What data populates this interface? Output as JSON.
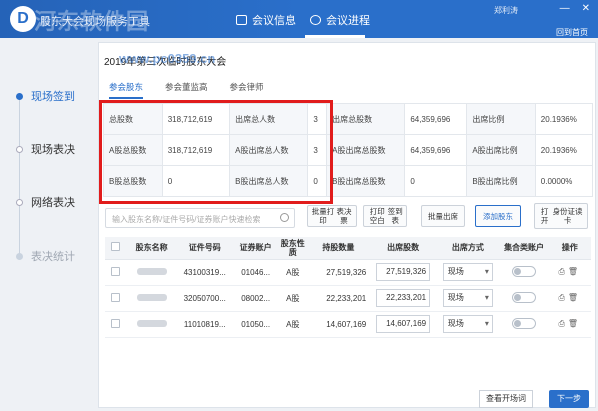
{
  "app": {
    "title": "股东大会现场服务工具",
    "watermark_top": "河东软件园",
    "user": "郑利涛",
    "window_controls": [
      "—",
      "✕"
    ],
    "back_home": "回到首页"
  },
  "nav": {
    "items": [
      {
        "label": "会议信息"
      },
      {
        "label": "会议进程"
      }
    ]
  },
  "sidebar": {
    "items": [
      {
        "label": "现场签到"
      },
      {
        "label": "现场表决"
      },
      {
        "label": "网络表决"
      },
      {
        "label": "表决统计"
      }
    ]
  },
  "main": {
    "meeting_title": "2019年第三次临时股东大会",
    "watermark": "www.pc0359.cn",
    "tabs": [
      {
        "label": "参会股东"
      },
      {
        "label": "参会董监高"
      },
      {
        "label": "参会律师"
      }
    ],
    "stats": [
      [
        "总股数",
        "318,712,619",
        "出席总人数",
        "3",
        "出席总股数",
        "64,359,696",
        "出席比例",
        "20.1936%"
      ],
      [
        "A股总股数",
        "318,712,619",
        "A股出席总人数",
        "3",
        "A股出席总股数",
        "64,359,696",
        "A股出席比例",
        "20.1936%"
      ],
      [
        "B股总股数",
        "0",
        "B股出席总人数",
        "0",
        "B股出席总股数",
        "0",
        "B股出席比例",
        "0.0000%"
      ]
    ],
    "search_placeholder": "输入股东名称/证件号码/证券账户快速检索",
    "buttons": {
      "batch_print": [
        "批量打印",
        "表决票"
      ],
      "print_blank": [
        "打印空白",
        "签到表"
      ],
      "batch_attend": "批量出席",
      "add_holder": "添加股东",
      "print_id": [
        "打开",
        "身份证读卡"
      ]
    },
    "table": {
      "headers": [
        "股东名称",
        "证件号码",
        "证券账户",
        "股东性质",
        "持股数量",
        "出席股数",
        "出席方式",
        "集合类账户",
        "操作"
      ],
      "rows": [
        {
          "id": "43100319...",
          "account": "01046...",
          "type": "A股",
          "holding": "27,519,326",
          "attend": "27,519,326",
          "mode": "现场"
        },
        {
          "id": "32050700...",
          "account": "08002...",
          "type": "A股",
          "holding": "22,233,201",
          "attend": "22,233,201",
          "mode": "现场"
        },
        {
          "id": "11010819...",
          "account": "01050...",
          "type": "A股",
          "holding": "14,607,169",
          "attend": "14,607,169",
          "mode": "现场"
        }
      ]
    },
    "footer": {
      "check_label": "查看开场词",
      "next_label": "下一步"
    }
  },
  "colors": {
    "accent": "#2a6fca",
    "highlight_box": "#e11c1c"
  }
}
